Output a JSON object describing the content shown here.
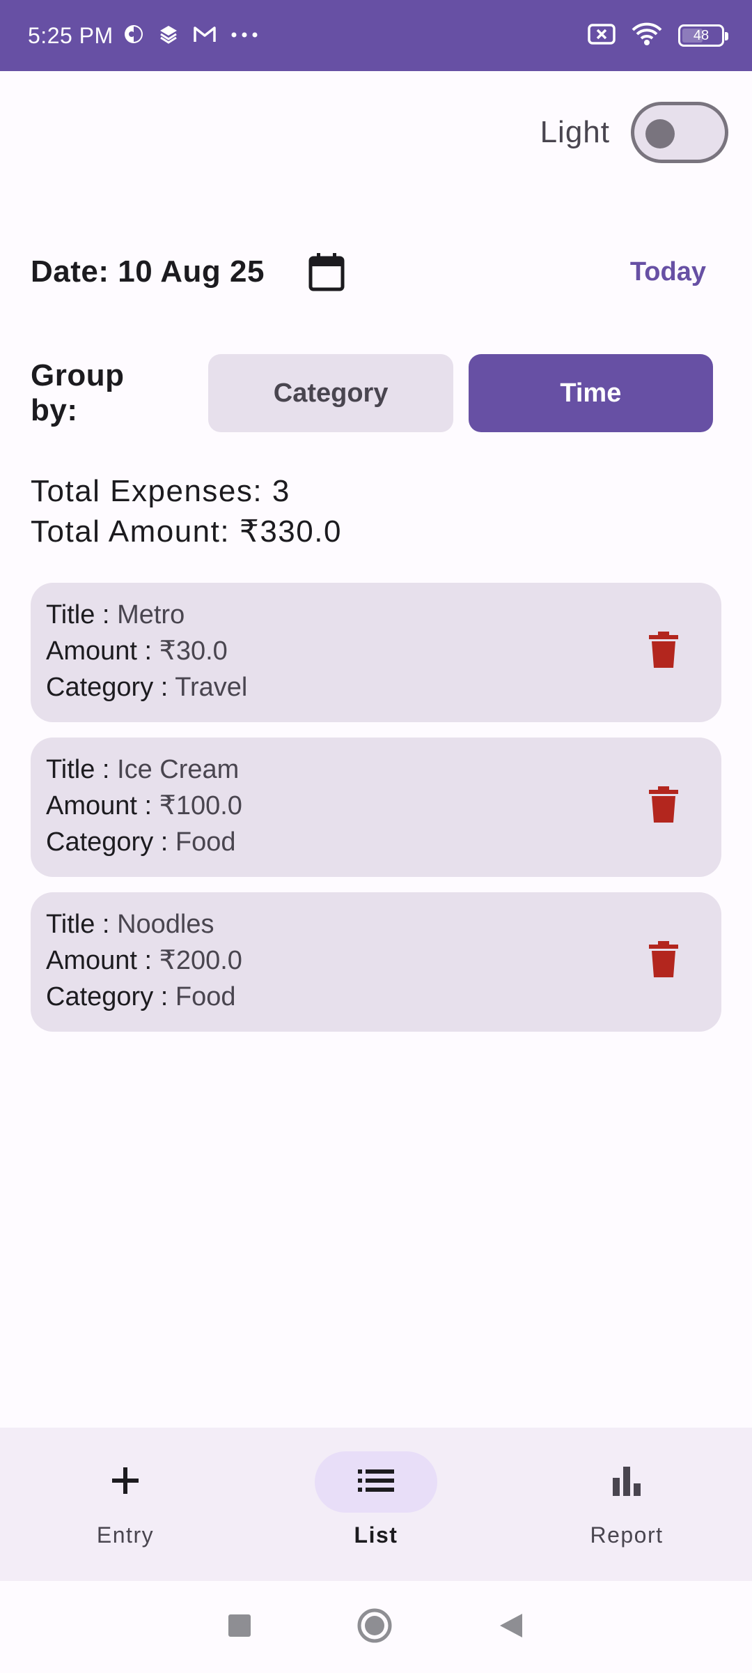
{
  "status_bar": {
    "time": "5:25 PM",
    "battery_level": "48",
    "left_icons": [
      "vpn-icon",
      "layers-icon",
      "gmail-icon",
      "more-dots-icon"
    ],
    "right_icons": [
      "no-sim-icon",
      "wifi-icon",
      "battery-icon"
    ]
  },
  "theme": {
    "label": "Light",
    "dark_mode_on": false
  },
  "date_row": {
    "date_text": "Date: 10 Aug 25",
    "today_label": "Today"
  },
  "group_by": {
    "label": "Group by:",
    "options": [
      {
        "label": "Category",
        "selected": false
      },
      {
        "label": "Time",
        "selected": true
      }
    ]
  },
  "totals": {
    "expenses_text": "Total Expenses: 3",
    "amount_text": "Total Amount: ₹330.0"
  },
  "expenses": [
    {
      "title_label": "Title : ",
      "title": "Metro",
      "amount_label": "Amount : ",
      "amount": "₹30.0",
      "category_label": "Category : ",
      "category": "Travel"
    },
    {
      "title_label": "Title : ",
      "title": "Ice Cream",
      "amount_label": "Amount : ",
      "amount": "₹100.0",
      "category_label": "Category : ",
      "category": "Food"
    },
    {
      "title_label": "Title : ",
      "title": "Noodles",
      "amount_label": "Amount : ",
      "amount": "₹200.0",
      "category_label": "Category : ",
      "category": "Food"
    }
  ],
  "bottom_nav": {
    "items": [
      {
        "label": "Entry",
        "icon": "plus-icon",
        "active": false
      },
      {
        "label": "List",
        "icon": "list-icon",
        "active": true
      },
      {
        "label": "Report",
        "icon": "bar-chart-icon",
        "active": false
      }
    ]
  },
  "colors": {
    "primary": "#6750a4",
    "surface_variant": "#e7e0ec",
    "delete": "#b3261e",
    "nav_background": "#f3edf7",
    "nav_indicator": "#e8def8"
  }
}
